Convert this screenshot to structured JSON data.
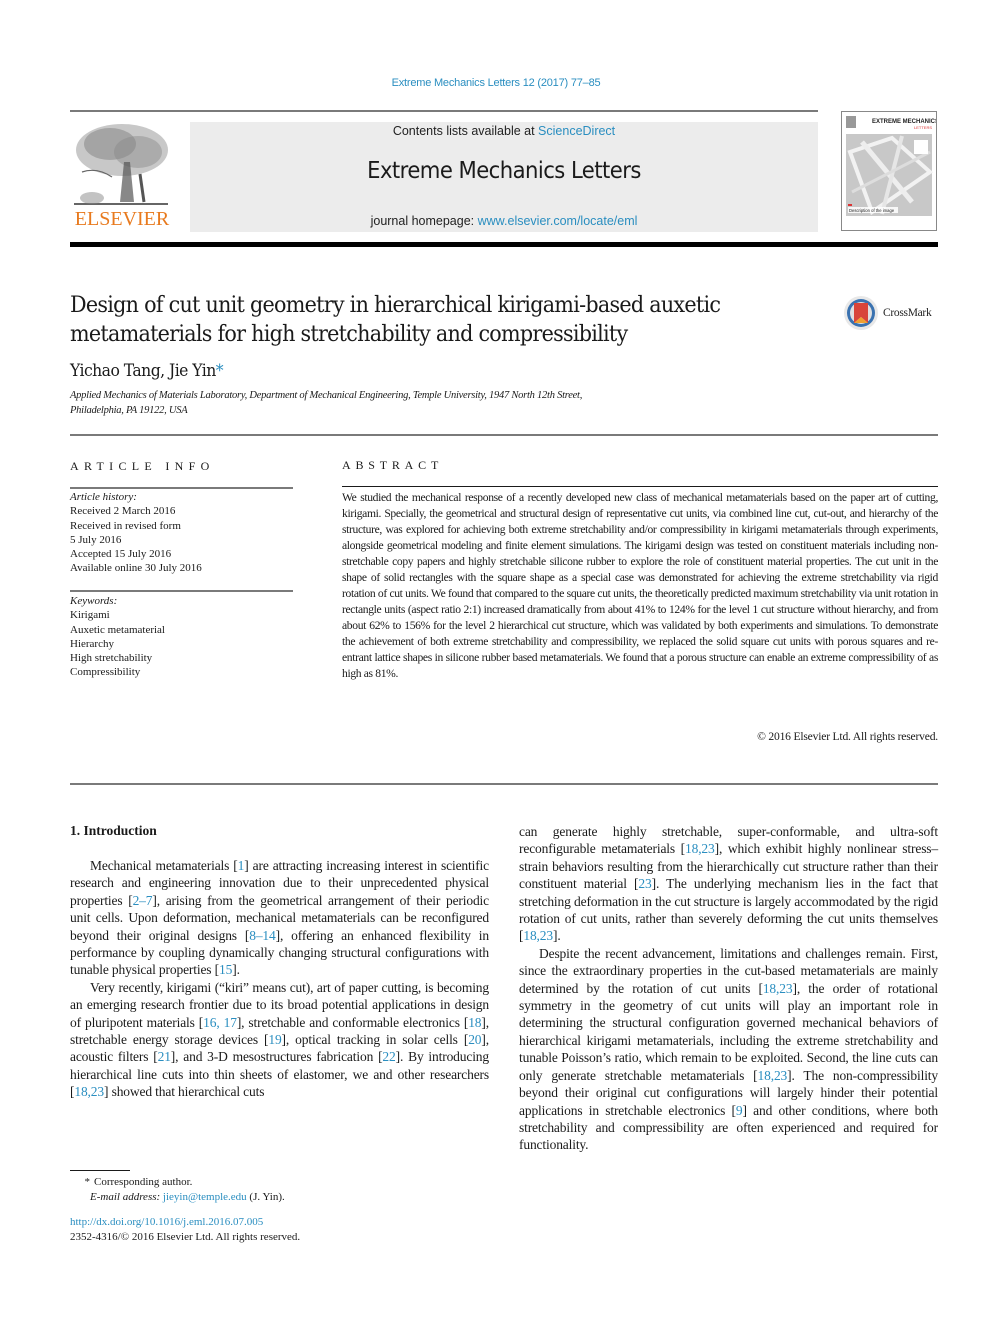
{
  "header": {
    "journal_ref": "Extreme Mechanics Letters 12 (2017) 77–85",
    "publisher_logo_text": "ELSEVIER",
    "contents_prefix": "Contents lists available at ",
    "contents_link": "ScienceDirect",
    "journal_title": "Extreme Mechanics Letters",
    "homepage_prefix": "journal homepage: ",
    "homepage_link": "www.elsevier.com/locate/eml",
    "cover": {
      "title": "EXTREME MECHANICS",
      "subtitle": "LETTERS",
      "caption": "Description of the image"
    }
  },
  "article": {
    "title_line1": "Design of cut unit geometry in hierarchical kirigami-based auxetic",
    "title_line2": "metamaterials for high stretchability and compressibility",
    "crossmark_label": "CrossMark",
    "authors": "Yichao Tang, Jie Yin",
    "corresponding_mark": "*",
    "affiliation_line1": "Applied Mechanics of Materials Laboratory, Department of Mechanical Engineering, Temple University, 1947 North 12th Street,",
    "affiliation_line2": "Philadelphia, PA 19122, USA"
  },
  "article_info": {
    "heading": "ARTICLE INFO",
    "history_label": "Article history:",
    "history": [
      "Received 2 March 2016",
      "Received in revised form",
      "5 July 2016",
      "Accepted 15 July 2016",
      "Available online 30 July 2016"
    ],
    "keywords_label": "Keywords:",
    "keywords": [
      "Kirigami",
      "Auxetic metamaterial",
      "Hierarchy",
      "High stretchability",
      "Compressibility"
    ]
  },
  "abstract": {
    "heading": "ABSTRACT",
    "text": "We studied the mechanical response of a recently developed new class of mechanical metamaterials based on the paper art of cutting, kirigami. Specially, the geometrical and structural design of representative cut units, via combined line cut, cut-out, and hierarchy of the structure, was explored for achieving both extreme stretchability and/or compressibility in kirigami metamaterials through experiments, alongside geometrical modeling and finite element simulations. The kirigami design was tested on constituent materials including non-stretchable copy papers and highly stretchable silicone rubber to explore the role of constituent material properties. The cut unit in the shape of solid rectangles with the square shape as a special case was demonstrated for achieving the extreme stretchability via rigid rotation of cut units. We found that compared to the square cut units, the theoretically predicted maximum stretchability via unit rotation in rectangle units (aspect ratio 2:1) increased dramatically from about 41% to 124% for the level 1 cut structure without hierarchy, and from about 62% to 156% for the level 2 hierarchical cut structure, which was validated by both experiments and simulations. To demonstrate the achievement of both extreme stretchability and compressibility, we replaced the solid square cut units with porous squares and re-entrant lattice shapes in silicone rubber based metamaterials. We found that a porous structure can enable an extreme compressibility of as high as 81%.",
    "copyright": "© 2016 Elsevier Ltd. All rights reserved."
  },
  "body": {
    "section_heading": "1.  Introduction",
    "p1": [
      {
        "t": "Mechanical metamaterials "
      },
      {
        "r": "[1]"
      },
      {
        "t": " are attracting increasing interest in scientific research and engineering innovation due to their unprecedented physical properties "
      },
      {
        "r": "[2–7]"
      },
      {
        "t": ", arising from the geometrical arrangement of their periodic unit cells. Upon deformation, mechanical metamaterials can be reconfigured beyond their original designs "
      },
      {
        "r": "[8–14]"
      },
      {
        "t": ", offering an enhanced flexibility in performance by coupling dynamically changing structural configurations with tunable physical properties "
      },
      {
        "r": "[15]"
      },
      {
        "t": "."
      }
    ],
    "p2": [
      {
        "t": "Very recently, kirigami (“kiri” means cut), art of paper cutting, is becoming an emerging research frontier due to its broad potential applications in design of pluripotent materials "
      },
      {
        "r": "[16, 17]"
      },
      {
        "t": ", stretchable and conformable electronics "
      },
      {
        "r": "[18]"
      },
      {
        "t": ", stretchable energy storage devices "
      },
      {
        "r": "[19]"
      },
      {
        "t": ", optical tracking in solar cells "
      },
      {
        "r": "[20]"
      },
      {
        "t": ", acoustic filters "
      },
      {
        "r": "[21]"
      },
      {
        "t": ", and 3-D mesostructures fabrication "
      },
      {
        "r": "[22]"
      },
      {
        "t": ". By introducing hierarchical line cuts into thin sheets of elastomer, we and other researchers "
      },
      {
        "r": "[18,23]"
      },
      {
        "t": " showed that hierarchical cuts"
      }
    ],
    "p3": [
      {
        "t": "can generate highly stretchable, super-conformable, and ultra-soft reconfigurable metamaterials "
      },
      {
        "r": "[18,23]"
      },
      {
        "t": ", which exhibit highly nonlinear stress–strain behaviors resulting from the hierarchically cut structure rather than their constituent material "
      },
      {
        "r": "[23]"
      },
      {
        "t": ". The underlying mechanism lies in the fact that stretching deformation in the cut structure is largely accommodated by the rigid rotation of cut units, rather than severely deforming the cut units themselves "
      },
      {
        "r": "[18,23]"
      },
      {
        "t": "."
      }
    ],
    "p4": [
      {
        "t": "Despite the recent advancement, limitations and challenges remain. First, since the extraordinary properties in the cut-based metamaterials are mainly determined by the rotation of cut units "
      },
      {
        "r": "[18,23]"
      },
      {
        "t": ", the order of rotational symmetry in the geometry of cut units will play an important role in determining the structural configuration governed mechanical behaviors of hierarchical kirigami metamaterials, including the extreme stretchability and tunable Poisson’s ratio, which remain to be exploited. Second, the line cuts can only generate stretchable metamaterials "
      },
      {
        "r": "[18,23]"
      },
      {
        "t": ". The non-compressibility beyond their original cut configurations will largely hinder their potential applications in stretchable electronics "
      },
      {
        "r": "[9]"
      },
      {
        "t": " and other conditions, where both stretchability and compressibility are often experienced and required for functionality."
      }
    ]
  },
  "footnote": {
    "star": "*",
    "corresponding": "Corresponding author.",
    "email_label": "E-mail address: ",
    "email": "jieyin@temple.edu",
    "email_suffix": " (J. Yin).",
    "doi": "http://dx.doi.org/10.1016/j.eml.2016.07.005",
    "issn_line": "2352-4316/© 2016 Elsevier Ltd. All rights reserved."
  },
  "colors": {
    "link": "#2a8ec0",
    "elsevier_orange": "#e87a1e",
    "masthead_bg": "#ececec"
  }
}
